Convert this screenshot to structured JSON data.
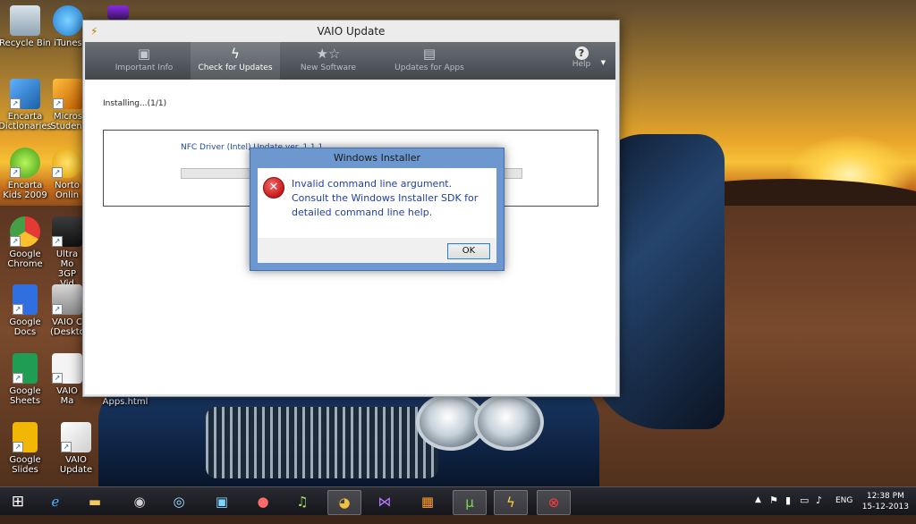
{
  "desktop": {
    "icons": [
      {
        "label": "Recycle Bin",
        "icon": "recycle-bin-icon"
      },
      {
        "label": "iTunes",
        "icon": "itunes-icon"
      },
      {
        "label": "Encarta Dictionaries",
        "icon": "encarta-dictionaries-icon"
      },
      {
        "label": "Micros Student",
        "icon": "microsoft-student-icon"
      },
      {
        "label": "Encarta Kids 2009",
        "icon": "encarta-kids-icon"
      },
      {
        "label": "Norto Onlin",
        "icon": "norton-online-icon"
      },
      {
        "label": "Google Chrome",
        "icon": "chrome-icon"
      },
      {
        "label": "Ultra Mo 3GP Vid",
        "icon": "ultra-mobile-3gp-icon"
      },
      {
        "label": "Google Docs",
        "icon": "google-docs-icon"
      },
      {
        "label": "VAIO C (Deskto",
        "icon": "vaio-care-icon"
      },
      {
        "label": "Google Sheets",
        "icon": "google-sheets-icon"
      },
      {
        "label": "VAIO Ma",
        "icon": "vaio-manual-icon"
      },
      {
        "label": "Google Slides",
        "icon": "google-slides-icon"
      },
      {
        "label": "VAIO Update",
        "icon": "vaio-update-icon"
      },
      {
        "label": "Apps.html",
        "icon": "html-file-icon"
      }
    ]
  },
  "vaio_window": {
    "title": "VAIO Update",
    "tabs": [
      {
        "label": "Important Info",
        "icon": "speech-bubble-icon"
      },
      {
        "label": "Check for Updates",
        "icon": "lightning-icon"
      },
      {
        "label": "New Software",
        "icon": "stars-icon"
      },
      {
        "label": "Updates for Apps",
        "icon": "clipboard-icon"
      }
    ],
    "help_label": "Help",
    "status": "Installing...(1/1)",
    "driver_label": "NFC Driver (Intel) Update ver. 1.1.1"
  },
  "installer_dialog": {
    "title": "Windows Installer",
    "message": "Invalid command line argument.  Consult the Windows Installer SDK for detailed command line help.",
    "ok_label": "OK"
  },
  "taskbar": {
    "apps": [
      "start",
      "internet-explorer",
      "file-explorer",
      "media-player",
      "itunes-circle",
      "video-app",
      "winamp",
      "chrome",
      "visual-studio",
      "metro-apps",
      "utorrent",
      "vaio-update",
      "windows-installer-error"
    ],
    "tray_lang": "ENG",
    "time": "12:38 PM",
    "date": "15-12-2013"
  },
  "colors": {
    "accent": "#6c97cf",
    "error_red": "#c81818",
    "link_blue": "#1f3fa8"
  }
}
